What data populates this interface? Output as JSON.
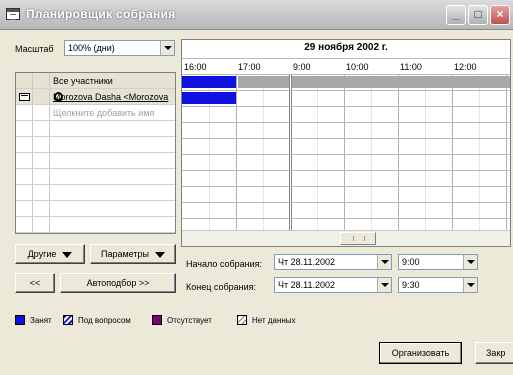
{
  "window": {
    "title": "Планировщик собрания"
  },
  "scale": {
    "label": "Масштаб",
    "value": "100% (дни)"
  },
  "attendees": {
    "header": "Все участники",
    "rows": [
      "Morozova Dasha <Morozova"
    ],
    "new_placeholder": "Щелкните добавить имя"
  },
  "buttons": {
    "others": "Другие",
    "options": "Параметры",
    "prev": "<<",
    "autopick": "Автоподбор >>",
    "organize": "Организовать",
    "close": "Закр"
  },
  "schedule": {
    "date": "29 ноября 2002 г.",
    "times": [
      "16:00",
      "17:00",
      "9:00",
      "10:00",
      "11:00",
      "12:00"
    ]
  },
  "meeting": {
    "start_label": "Начало собрания:",
    "start_date": "Чт 28.11.2002",
    "start_time": "9:00",
    "end_label": "Конец собрания:",
    "end_date": "Чт 28.11.2002",
    "end_time": "9:30"
  },
  "legend": {
    "busy": "Занят",
    "tentative": "Под вопросом",
    "out_of_office": "Отсутствует",
    "no_info": "Нет данных"
  },
  "colors": {
    "busy": "#1010e0",
    "out_of_office": "#800080",
    "title_bar": "#c4c4c4"
  }
}
